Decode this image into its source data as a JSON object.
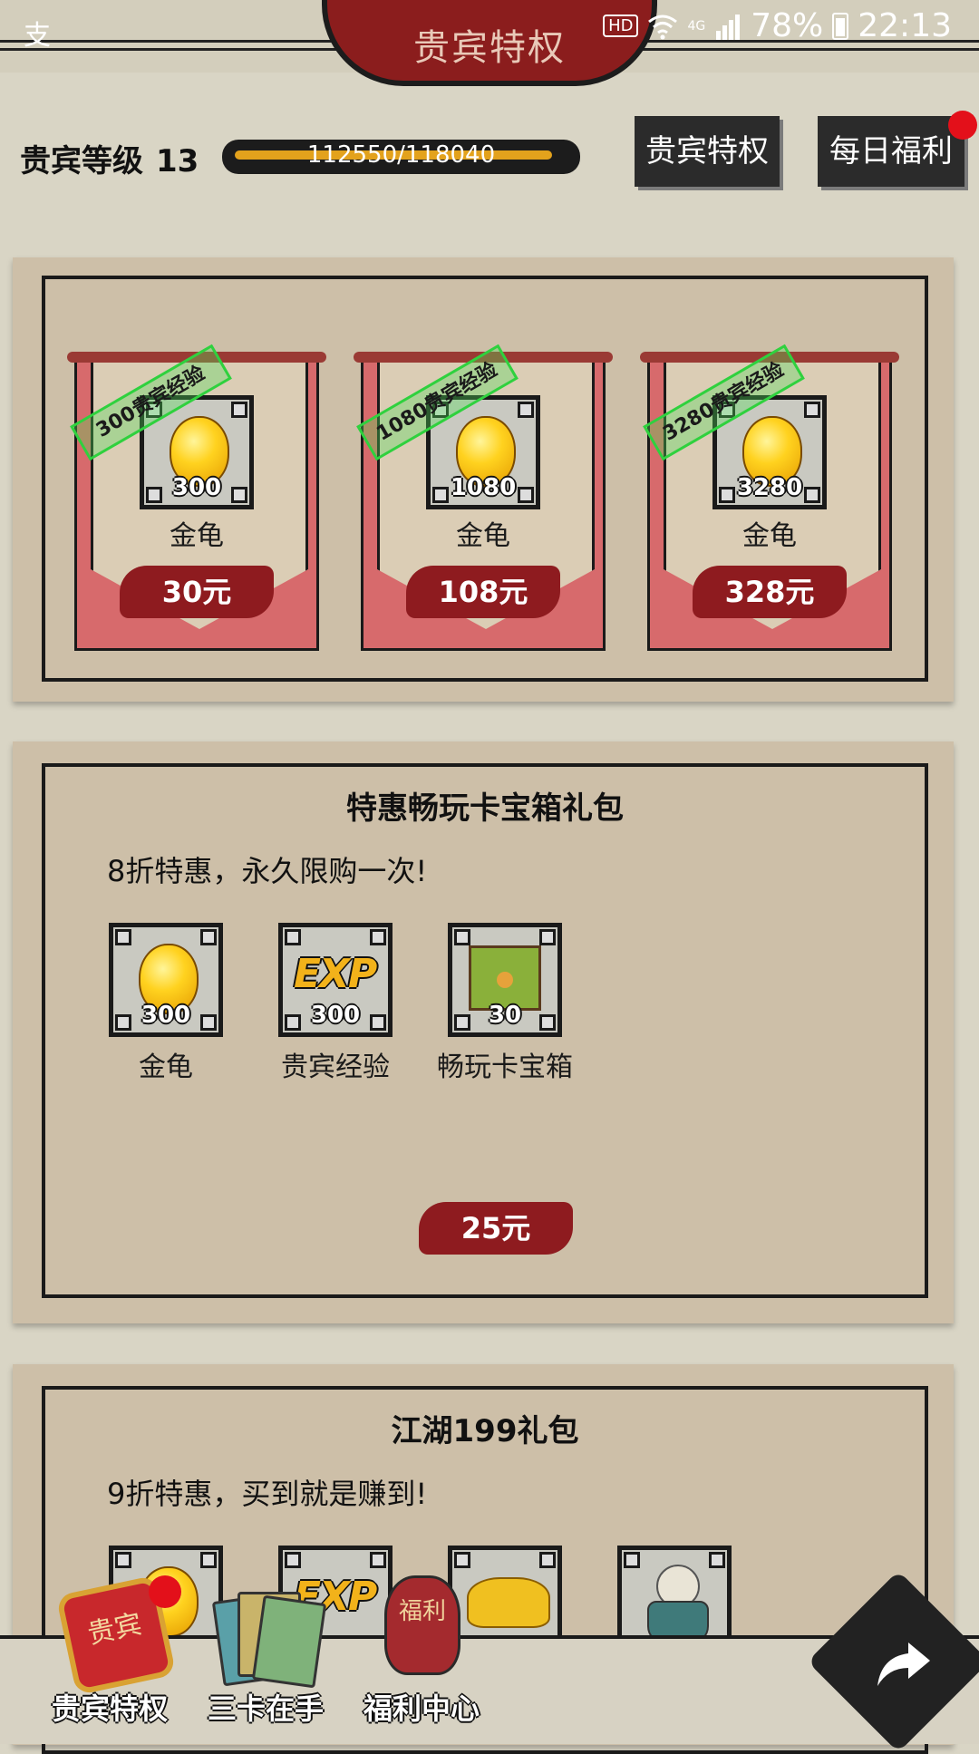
{
  "status_bar": {
    "left_icon": "alipay-icon",
    "left_glyph": "支",
    "hd": "HD",
    "network": "4G",
    "battery": "78%",
    "time": "22:13"
  },
  "title": "贵宾特权",
  "vip": {
    "level_label": "贵宾等级",
    "level": "13",
    "exp_text": "112550/118040",
    "exp_progress": 0.9535
  },
  "buttons": {
    "privilege": "贵宾特权",
    "daily": "每日福利"
  },
  "packs": [
    {
      "tag": "300贵宾经验",
      "qty": "300",
      "name": "金龟",
      "price": "30元"
    },
    {
      "tag": "1080贵宾经验",
      "qty": "1080",
      "name": "金龟",
      "price": "108元"
    },
    {
      "tag": "3280贵宾经验",
      "qty": "3280",
      "name": "金龟",
      "price": "328元"
    }
  ],
  "bundle1": {
    "title": "特惠畅玩卡宝箱礼包",
    "desc": "8折特惠，永久限购一次!",
    "items": [
      {
        "qty": "300",
        "name": "金龟",
        "icon": "gold-turtle-icon"
      },
      {
        "qty": "300",
        "name": "贵宾经验",
        "icon": "exp-icon",
        "icon_text": "EXP"
      },
      {
        "qty": "30",
        "name": "畅玩卡宝箱",
        "icon": "chest-icon"
      }
    ],
    "price": "25元"
  },
  "bundle2": {
    "title": "江湖199礼包",
    "desc": "9折特惠，买到就是赚到!",
    "items": [
      {
        "icon": "gold-turtle-icon"
      },
      {
        "icon": "exp-icon",
        "icon_text": "EXP"
      },
      {
        "icon": "gold-ingot-icon"
      },
      {
        "icon": "pearl-urn-icon"
      }
    ]
  },
  "bottom_nav": {
    "vip": {
      "label": "贵宾特权",
      "icon_text": "贵宾"
    },
    "cards": {
      "label": "三卡在手"
    },
    "welfare": {
      "label": "福利中心",
      "icon_text": "福利"
    }
  },
  "colors": {
    "title_plate": "#8b1d1d",
    "price_ink": "#8e1b1f",
    "pack_frame": "#d76a6c",
    "exp_fill": "#e3a21c",
    "badge_red": "#e3101a",
    "exp_tag_green": "#2fd13e"
  }
}
